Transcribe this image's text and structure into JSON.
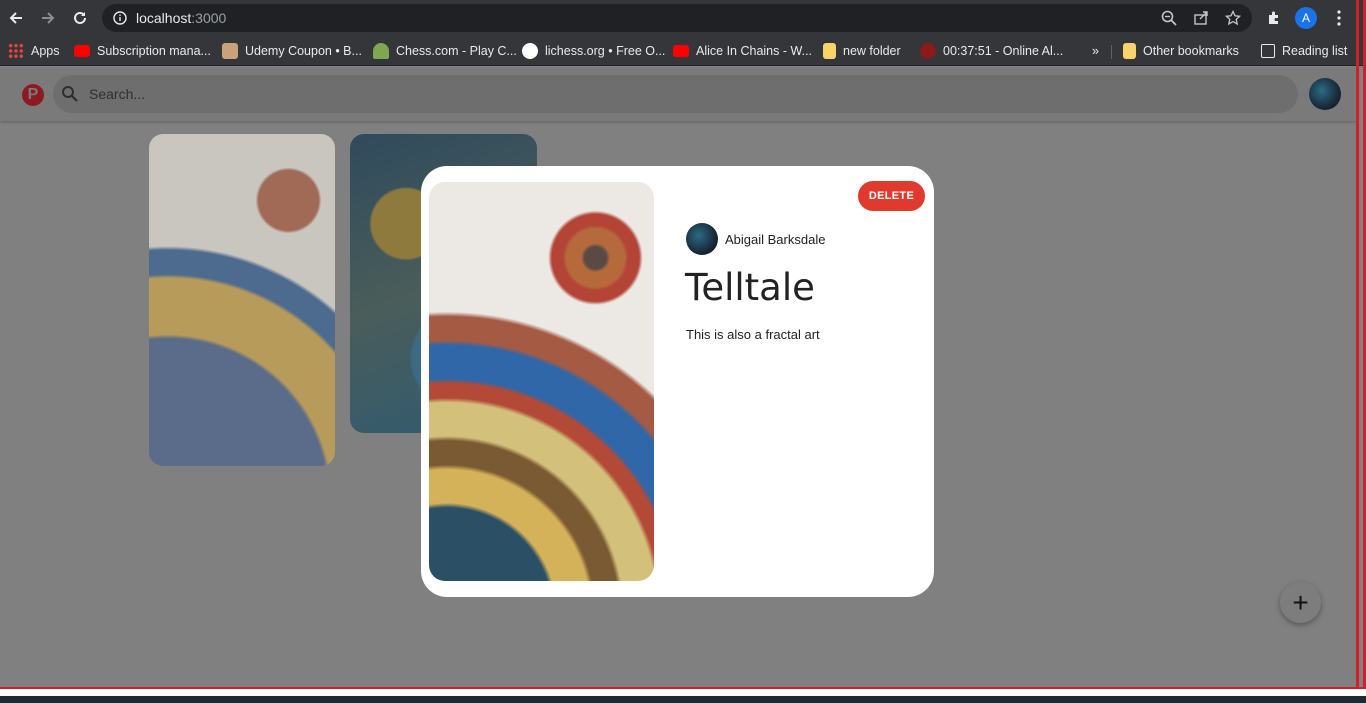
{
  "browser": {
    "url_host": "localhost",
    "url_port": ":3000",
    "profile_initial": "A",
    "bookmarks": [
      {
        "label": "Apps",
        "icon": "apps-grid-icon",
        "color": "#e8453c"
      },
      {
        "label": "Subscription mana...",
        "icon": "youtube-icon",
        "color": "#ff0000"
      },
      {
        "label": "Udemy Coupon • B...",
        "icon": "udemy-icon",
        "color": "#c9a27a"
      },
      {
        "label": "Chess.com - Play C...",
        "icon": "chess-pawn-icon",
        "color": "#7fa650"
      },
      {
        "label": "lichess.org • Free O...",
        "icon": "lichess-icon",
        "color": "#ffffff"
      },
      {
        "label": "Alice In Chains - W...",
        "icon": "youtube-icon",
        "color": "#ff0000"
      },
      {
        "label": "new folder",
        "icon": "folder-icon",
        "color": "#f6d46a"
      },
      {
        "label": "00:37:51 - Online Al...",
        "icon": "record-icon",
        "color": "#8b1a1a"
      }
    ],
    "other_bookmarks": "Other bookmarks",
    "reading_list": "Reading list",
    "overflow": "»"
  },
  "app": {
    "logo": "P",
    "search_placeholder": "Search..."
  },
  "modal": {
    "delete_label": "DELETE",
    "author": "Abigail Barksdale",
    "title": "Telltale",
    "description": "This is also a fractal art"
  },
  "fab_label": "+",
  "colors": {
    "delete": "#e03a2f",
    "overlay": "#808080",
    "pinterest_red": "#8c1a20"
  }
}
